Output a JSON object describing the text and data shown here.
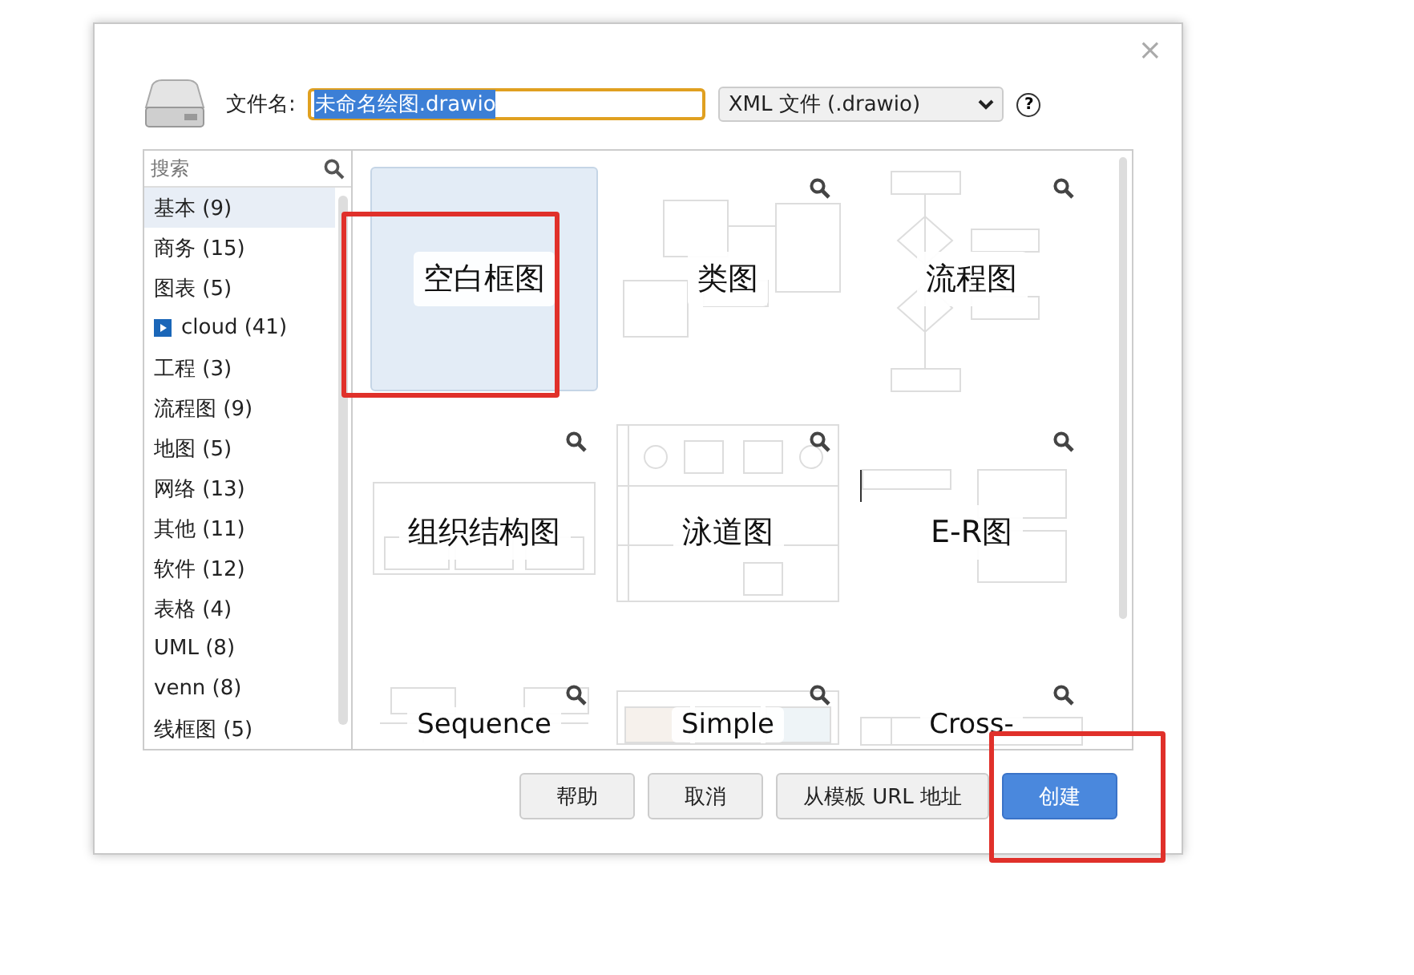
{
  "dialog": {
    "filename_label": "文件名:",
    "filename_value": "未命名绘图.drawio",
    "filename_selected": true,
    "format": "XML 文件 (.drawio)",
    "help_mark": "?",
    "close": "×"
  },
  "sidebar": {
    "search_placeholder": "搜索",
    "items": [
      {
        "label": "基本 (9)",
        "selected": true,
        "kind": "plain"
      },
      {
        "label": "商务 (15)",
        "selected": false,
        "kind": "plain"
      },
      {
        "label": "图表 (5)",
        "selected": false,
        "kind": "plain"
      },
      {
        "label": "cloud (41)",
        "selected": false,
        "kind": "icon"
      },
      {
        "label": "工程 (3)",
        "selected": false,
        "kind": "plain"
      },
      {
        "label": "流程图 (9)",
        "selected": false,
        "kind": "plain"
      },
      {
        "label": "地图 (5)",
        "selected": false,
        "kind": "plain"
      },
      {
        "label": "网络 (13)",
        "selected": false,
        "kind": "plain"
      },
      {
        "label": "其他 (11)",
        "selected": false,
        "kind": "plain"
      },
      {
        "label": "软件 (12)",
        "selected": false,
        "kind": "plain"
      },
      {
        "label": "表格 (4)",
        "selected": false,
        "kind": "plain"
      },
      {
        "label": "UML (8)",
        "selected": false,
        "kind": "plain"
      },
      {
        "label": "venn (8)",
        "selected": false,
        "kind": "plain"
      },
      {
        "label": "线框图 (5)",
        "selected": false,
        "kind": "plain"
      }
    ]
  },
  "templates": [
    {
      "label": "空白框图",
      "selected": true,
      "kind": "blank"
    },
    {
      "label": "类图",
      "selected": false,
      "kind": "class"
    },
    {
      "label": "流程图",
      "selected": false,
      "kind": "flow"
    },
    {
      "label": "组织结构图",
      "selected": false,
      "kind": "org"
    },
    {
      "label": "泳道图",
      "selected": false,
      "kind": "swimlane"
    },
    {
      "label": "E-R图",
      "selected": false,
      "kind": "er"
    },
    {
      "label": "Sequence",
      "selected": false,
      "kind": "sequence"
    },
    {
      "label": "Simple",
      "selected": false,
      "kind": "simple"
    },
    {
      "label": "Cross-",
      "selected": false,
      "kind": "cross"
    }
  ],
  "buttons": [
    {
      "label": "帮助",
      "kind": "plain"
    },
    {
      "label": "取消",
      "kind": "plain"
    },
    {
      "label": "从模板 URL 地址",
      "kind": "plain"
    },
    {
      "label": "创建",
      "kind": "primary"
    }
  ]
}
